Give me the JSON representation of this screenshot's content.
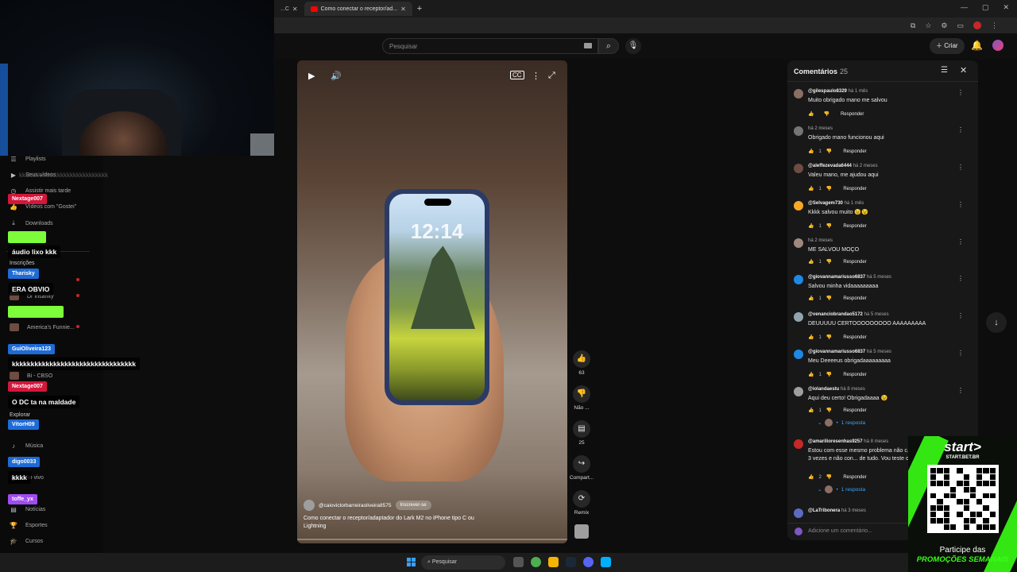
{
  "browser": {
    "tabs": [
      {
        "label": "...C",
        "active": false
      },
      {
        "label": "Como conectar o receptor/ad...",
        "active": true
      }
    ],
    "new_tab": "+",
    "window_controls": [
      "—",
      "▢",
      "✕"
    ]
  },
  "yt_header": {
    "search_placeholder": "Pesquisar",
    "create_label": "Criar"
  },
  "sidebar": {
    "items": [
      {
        "label": "Playlists",
        "icon": "playlist-icon"
      },
      {
        "label": "Seus vídeos",
        "icon": "video-icon"
      },
      {
        "label": "Assistir mais tarde",
        "icon": "clock-icon"
      },
      {
        "label": "Vídeos com \"Gostei\"",
        "icon": "like-icon"
      },
      {
        "label": "Downloads",
        "icon": "download-icon"
      }
    ],
    "subscriptions_heading": "Inscrições",
    "channels": [
      "Dr Insanity",
      "America's Funnie...",
      "Bi - CBSO"
    ],
    "explore_heading": "Explorar",
    "explore_items": [
      "Música",
      "Ao vivo",
      "Notícias",
      "Esportes",
      "Cursos"
    ]
  },
  "chat": {
    "background_text": "kkkkkkkkkkkkkkkkkkkkkkkkkkkk",
    "messages": [
      {
        "user": "Nextage007",
        "color": "#d3173c",
        "text": ""
      },
      {
        "user": "",
        "color": "#7cfc3a",
        "text": "áudio lixo kkk"
      },
      {
        "user": "Tharisky",
        "color": "#1e6bd6",
        "text": "ERA OBVIO"
      },
      {
        "user": "",
        "color": "#7cfc3a",
        "text": ""
      },
      {
        "user": "GuiOliveira123",
        "color": "#1e6bd6",
        "text": "kkkkkkkkkkkkkkkkkkkkkkkkkkkkkkkkk"
      },
      {
        "user": "Nextage007",
        "color": "#d3173c",
        "text": "O DC ta na maldade"
      },
      {
        "user": "VitorH09",
        "color": "#1e6bd6",
        "text": ""
      },
      {
        "user": "digo0033",
        "color": "#1e6bd6",
        "text": "kkkk"
      },
      {
        "user": "toffe_yx",
        "color": "#a04cf0",
        "text": ""
      }
    ]
  },
  "video": {
    "channel": "@caiovictorbarreiraoliveira8575",
    "subscribe_label": "Inscrever-se",
    "title": "Como conectar o receptor/adaptador do Lark M2 no iPhone tipo C ou Lightning",
    "phone_clock": "12:14",
    "progress_fraction": 0.0
  },
  "actions": [
    {
      "icon": "like-icon",
      "label": "63"
    },
    {
      "icon": "dislike-icon",
      "label": "Não ..."
    },
    {
      "icon": "comment-icon",
      "label": "25"
    },
    {
      "icon": "share-icon",
      "label": "Compart..."
    },
    {
      "icon": "remix-icon",
      "label": "Remix"
    }
  ],
  "comments": {
    "title": "Comentários",
    "count": "25",
    "add_placeholder": "Adicione um comentário...",
    "reply_label": "Responder",
    "items": [
      {
        "author": "@gilespaulo8329",
        "time": "há 1 mês",
        "text": "Muito obrigado mano me salvou",
        "likes": "",
        "avatar": "#8d6e63"
      },
      {
        "author": "",
        "time": "há 2 meses",
        "text": "Obrigado mano funcionou aqui",
        "likes": "1",
        "avatar": "#757575"
      },
      {
        "author": "@aleffezevada6444",
        "time": "há 2 meses",
        "text": "Valeu mano, me ajudou aqui",
        "likes": "1",
        "avatar": "#6d4c41"
      },
      {
        "author": "@Selvagem730",
        "time": "há 1 mês",
        "text": "Kkkk salvou muito 😉😉",
        "likes": "1",
        "avatar": "#f9a825"
      },
      {
        "author": "",
        "time": "há 2 meses",
        "text": "ME SALVOU MOÇO",
        "likes": "1",
        "avatar": "#a1887f"
      },
      {
        "author": "@giovannamariusso6837",
        "time": "há 5 meses",
        "text": "Salvou minha vidaaaaaaaaa",
        "likes": "1",
        "avatar": "#1e88e5"
      },
      {
        "author": "@venanciobrandao5172",
        "time": "há 5 meses",
        "text": "DEUUUUU CERTOOOOOOOOO AAAAAAAAA",
        "likes": "1",
        "avatar": "#90a4ae"
      },
      {
        "author": "@giovannamariusso6837",
        "time": "há 5 meses",
        "text": "Meu Deeeeus obrigadaaaaaaaaa",
        "likes": "1",
        "avatar": "#1e88e5"
      },
      {
        "author": "@iolandaestu",
        "time": "há 8 meses",
        "text": "Aqui deu certo! Obrigadaaaa 😉",
        "likes": "1",
        "avatar": "#9e9e9e",
        "replies": "1 resposta"
      },
      {
        "author": "@amarilioresenhas9257",
        "time": "há 8 meses",
        "text": "Estou com esse mesmo problema não c... comprei ele e só usei 3 vezes e não con... de tudo. Vou teste o que vc falou no víde...",
        "likes": "2",
        "avatar": "#c62828",
        "replies": "1 resposta"
      },
      {
        "author": "@LaTribonera",
        "time": "há 3 meses",
        "text": "",
        "likes": "",
        "avatar": "#5c6bc0"
      }
    ]
  },
  "ad": {
    "brand": "start>",
    "site": "START.BET.BR",
    "cta_line1": "Participe das",
    "cta_line2": "PROMOÇÕES SEMANAIS"
  },
  "taskbar": {
    "search_label": "Pesquisar"
  }
}
